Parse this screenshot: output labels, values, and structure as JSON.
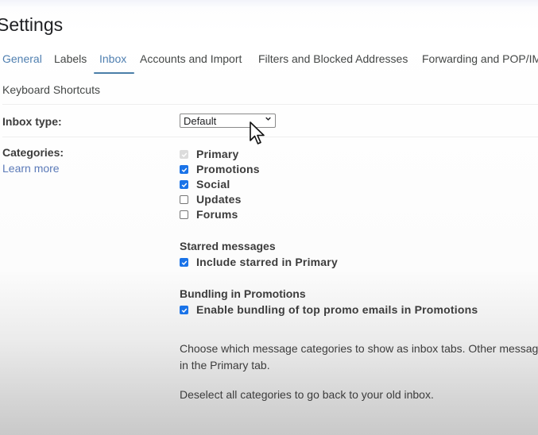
{
  "page": {
    "title": "Settings"
  },
  "tabs": {
    "items": [
      {
        "label": "General"
      },
      {
        "label": "Labels"
      },
      {
        "label": "Inbox"
      },
      {
        "label": "Accounts and Import"
      },
      {
        "label": "Filters and Blocked Addresses"
      },
      {
        "label": "Forwarding and POP/IM"
      }
    ],
    "second_row": [
      {
        "label": "Keyboard Shortcuts"
      }
    ],
    "active": "Inbox"
  },
  "inbox_type": {
    "label": "Inbox type:",
    "selected": "Default"
  },
  "categories": {
    "label": "Categories:",
    "learn_more": "Learn more",
    "items": [
      {
        "label": "Primary",
        "checked": true,
        "disabled": true
      },
      {
        "label": "Promotions",
        "checked": true,
        "disabled": false
      },
      {
        "label": "Social",
        "checked": true,
        "disabled": false
      },
      {
        "label": "Updates",
        "checked": false,
        "disabled": false
      },
      {
        "label": "Forums",
        "checked": false,
        "disabled": false
      }
    ]
  },
  "starred": {
    "heading": "Starred messages",
    "option": {
      "label": "Include starred in Primary",
      "checked": true
    }
  },
  "bundling": {
    "heading": "Bundling in Promotions",
    "option": {
      "label": "Enable bundling of top promo emails in Promotions",
      "checked": true
    }
  },
  "help": {
    "line1": "Choose which message categories to show as inbox tabs. Other message",
    "line2": "in the Primary tab.",
    "line3": "Deselect all categories to go back to your old inbox."
  },
  "colors": {
    "accent": "#1a73e8",
    "active_tab": "#4f7fb0",
    "link": "#5b7ab8"
  }
}
